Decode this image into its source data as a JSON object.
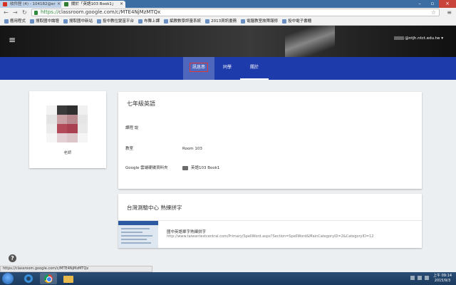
{
  "browser": {
    "tabs": [
      {
        "title": "收件匣 (4) - 104182@er",
        "active": false,
        "favicon_color": "#d93025"
      },
      {
        "title": "關於「英語103 Book1」",
        "active": true,
        "favicon_color": "#2e7d32"
      }
    ],
    "url_secure": "https://",
    "url_host": "classroom.google.com",
    "url_path": "/c/MTE4NjMzMTQx",
    "bookmarks": [
      "應用程式",
      "搜取國中論壇",
      "搜取國中新站",
      "投中教位變富平台",
      "布舞上課",
      "編教數學評量系統",
      "2013資訊畫務",
      "電腦教室故障報修",
      "投中電子書櫃"
    ]
  },
  "header": {
    "account": "@ntjh.ntct.edu.tw"
  },
  "nav": {
    "tabs": [
      "訊息串",
      "同學",
      "關於"
    ],
    "active_tab": "關於",
    "highlighted_tab": "訊息串"
  },
  "teacher": {
    "label": "老師"
  },
  "about": {
    "class_name": "七年級英語",
    "rows": [
      {
        "label": "課程 說",
        "value": ""
      },
      {
        "label": "教室",
        "value": "Room 103"
      },
      {
        "label": "Google 雲端硬碟資料夾",
        "value": "英語103 Book1"
      }
    ]
  },
  "resource": {
    "title": "台灣測驗中心 熟練拼字",
    "link_title": "國中英語單字熟練拼字",
    "link_url": "http://www.taiwantestcentral.com/Primary/SpellWord.aspx?Section=SpellWord&MainCategoryID=2&CategoryID=12"
  },
  "status_url": "https://classroom.google.com/c/MTE4NjMzMTQx",
  "taskbar": {
    "time": "上午 09:14",
    "date": "2015/9/3"
  },
  "colors": {
    "nav_bar": "#1e3bab",
    "highlight_border": "#e53935",
    "secure_url": "#2e8b3d"
  }
}
